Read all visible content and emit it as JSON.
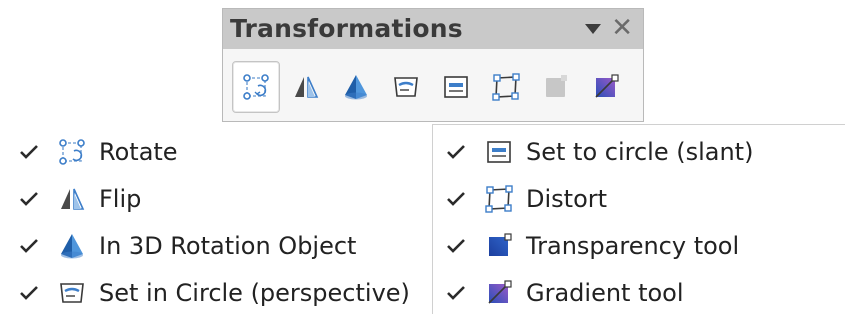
{
  "toolbar": {
    "title": "Transformations",
    "menu_icon": "dropdown-arrow-icon",
    "close_icon": "close-icon",
    "buttons": [
      {
        "icon": "rotate-icon",
        "active": true
      },
      {
        "icon": "flip-icon"
      },
      {
        "icon": "3d-rotation-object-icon"
      },
      {
        "icon": "set-in-circle-perspective-icon"
      },
      {
        "icon": "set-to-circle-slant-icon"
      },
      {
        "icon": "distort-icon"
      },
      {
        "icon": "transparency-tool-icon",
        "disabled": true
      },
      {
        "icon": "gradient-tool-icon"
      }
    ]
  },
  "menu": {
    "left": [
      {
        "label": "Rotate",
        "checked": true,
        "icon": "rotate-icon"
      },
      {
        "label": "Flip",
        "checked": true,
        "icon": "flip-icon"
      },
      {
        "label": "In 3D Rotation Object",
        "checked": true,
        "icon": "3d-rotation-object-icon"
      },
      {
        "label": "Set in Circle (perspective)",
        "checked": true,
        "icon": "set-in-circle-perspective-icon"
      }
    ],
    "right": [
      {
        "label": "Set to circle (slant)",
        "checked": true,
        "icon": "set-to-circle-slant-icon"
      },
      {
        "label": "Distort",
        "checked": true,
        "icon": "distort-icon"
      },
      {
        "label": "Transparency tool",
        "checked": true,
        "icon": "transparency-tool-icon"
      },
      {
        "label": "Gradient tool",
        "checked": true,
        "icon": "gradient-tool-icon"
      }
    ]
  },
  "colors": {
    "accent_blue": "#3d7ec9",
    "title_bar": "#c9c9c9",
    "toolbar_bg": "#f6f6f6"
  }
}
